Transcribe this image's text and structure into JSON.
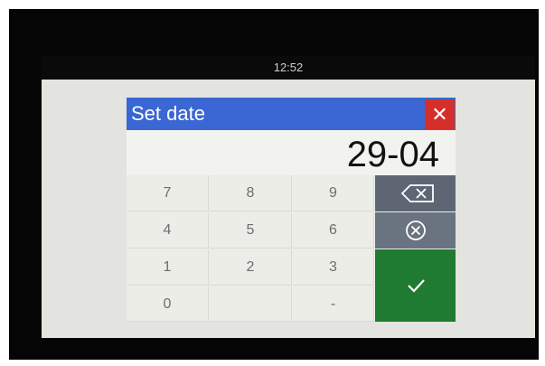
{
  "status_bar": {
    "time": "12:52"
  },
  "dialog": {
    "title": "Set date",
    "close_symbol": "✕",
    "value": "29-04"
  },
  "keypad": {
    "keys": [
      "7",
      "8",
      "9",
      "4",
      "5",
      "6",
      "1",
      "2",
      "3",
      "0",
      "",
      "-"
    ]
  },
  "actions": {
    "backspace_icon": "backspace-icon",
    "clear_icon": "clear-circle-x-icon",
    "confirm_icon": "checkmark-icon"
  },
  "colors": {
    "titlebar": "#3a67d4",
    "close": "#d42f2b",
    "confirm": "#1e7b31",
    "action_gray": "#5e6673"
  }
}
